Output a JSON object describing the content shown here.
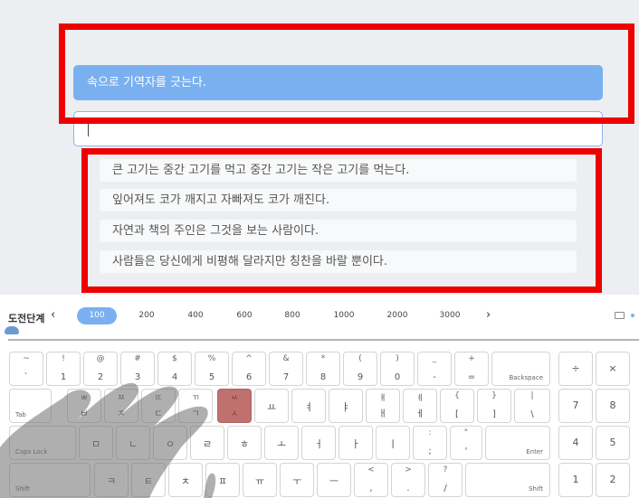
{
  "current_sentence": "속으로 기역자를 긋는다.",
  "input_value": "",
  "upcoming_sentences": [
    "큰 고기는 중간 고기를 먹고 중간 고기는 작은 고기를 먹는다.",
    "잎어져도 코가 깨지고 자빠져도 코가 깨진다.",
    "자연과 책의 주인은 그것을 보는 사람이다.",
    "사람들은 당신에게 비평해 달라지만 칭찬을 바랄 뿐이다."
  ],
  "challenge": {
    "label": "도전단계",
    "prev": "‹",
    "next": "›",
    "levels": [
      "100",
      "200",
      "400",
      "600",
      "800",
      "1000",
      "2000",
      "3000"
    ],
    "active_level": "100"
  },
  "keyboard": {
    "row1": [
      {
        "t": "~",
        "b": "`"
      },
      {
        "t": "!",
        "b": "1"
      },
      {
        "t": "@",
        "b": "2"
      },
      {
        "t": "#",
        "b": "3"
      },
      {
        "t": "$",
        "b": "4"
      },
      {
        "t": "%",
        "b": "5"
      },
      {
        "t": "^",
        "b": "6"
      },
      {
        "t": "&",
        "b": "7"
      },
      {
        "t": "*",
        "b": "8"
      },
      {
        "t": "(",
        "b": "9"
      },
      {
        "t": ")",
        "b": "0"
      },
      {
        "t": "_",
        "b": "-"
      },
      {
        "t": "+",
        "b": "="
      }
    ],
    "backspace": "Backspace",
    "tab": "Tab",
    "row2": [
      {
        "t": "ㅃ",
        "b": "ㅂ"
      },
      {
        "t": "ㅉ",
        "b": "ㅈ"
      },
      {
        "t": "ㄸ",
        "b": "ㄷ"
      },
      {
        "t": "ㄲ",
        "b": "ㄱ"
      },
      {
        "t": "ㅆ",
        "b": "ㅅ"
      },
      {
        "t": "",
        "b": "ㅛ"
      },
      {
        "t": "",
        "b": "ㅕ"
      },
      {
        "t": "",
        "b": "ㅑ"
      },
      {
        "t": "ㅒ",
        "b": "ㅐ"
      },
      {
        "t": "ㅖ",
        "b": "ㅔ"
      },
      {
        "t": "{",
        "b": "["
      },
      {
        "t": "}",
        "b": "]"
      },
      {
        "t": "|",
        "b": "\\"
      }
    ],
    "capslock": "Caps Lock",
    "row3": [
      "ㅁ",
      "ㄴ",
      "ㅇ",
      "ㄹ",
      "ㅎ",
      "ㅗ",
      "ㅓ",
      "ㅏ",
      "ㅣ",
      ":;",
      "\"'"
    ],
    "row3_extra": [
      {
        "t": ":",
        "b": ";"
      },
      {
        "t": "\"",
        "b": "'"
      }
    ],
    "enter": "Enter",
    "shift": "Shift",
    "row4": [
      "ㅋ",
      "ㅌ",
      "ㅊ",
      "ㅍ",
      "ㅠ",
      "ㅜ",
      "ㅡ"
    ],
    "row4_extra": [
      {
        "t": "<",
        "b": ","
      },
      {
        "t": ">",
        "b": "."
      },
      {
        "t": "?",
        "b": "/"
      }
    ],
    "numpad": {
      "row1": [
        "÷",
        "×"
      ],
      "row2": [
        "7",
        "8"
      ],
      "row3": [
        "4",
        "5"
      ],
      "row4": [
        "1",
        "2"
      ]
    }
  },
  "colors": {
    "accent": "#7ab0ef",
    "highlight_box": "#ee0000",
    "key_highlight": "#c0716f"
  }
}
